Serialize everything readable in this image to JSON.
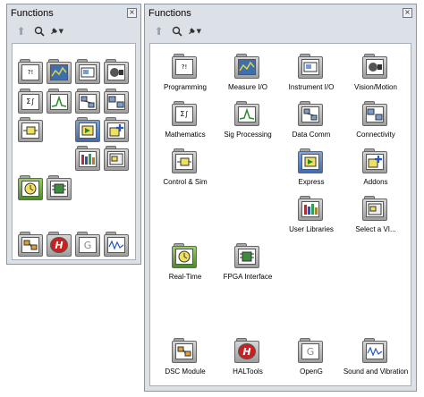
{
  "colors": {
    "window_bg": "#dce1e8",
    "content_bg": "#ffffff",
    "border": "#8a96a6",
    "folder_gray": "#b5b5b5",
    "hal_red": "#cc1f1f",
    "express_blue": "#1f5fbf",
    "addons_blue": "#2255cc",
    "fpga_green": "#3d8b3d",
    "measure_yellow": "#e8d040"
  },
  "small_window": {
    "title": "Functions",
    "close_icon": "close-icon",
    "toolbar": {
      "up_icon": "up-arrow-icon",
      "search_icon": "search-icon",
      "customize_icon": "wrench-icon"
    }
  },
  "large_window": {
    "title": "Functions",
    "close_icon": "close-icon",
    "toolbar": {
      "up_icon": "up-arrow-icon",
      "search_icon": "search-icon",
      "customize_icon": "wrench-icon"
    },
    "items": [
      {
        "label": "Programming",
        "icon": "programming-icon"
      },
      {
        "label": "Measure I/O",
        "icon": "measure-io-icon"
      },
      {
        "label": "Instrument I/O",
        "icon": "instrument-io-icon"
      },
      {
        "label": "Vision/Motion",
        "icon": "vision-motion-icon"
      },
      {
        "label": "Mathematics",
        "icon": "mathematics-icon"
      },
      {
        "label": "Sig Processing",
        "icon": "sig-processing-icon"
      },
      {
        "label": "Data Comm",
        "icon": "data-comm-icon"
      },
      {
        "label": "Connectivity",
        "icon": "connectivity-icon"
      },
      {
        "label": "Control & Sim",
        "icon": "control-sim-icon"
      },
      {
        "label": "Express",
        "icon": "express-icon"
      },
      {
        "label": "Addons",
        "icon": "addons-icon"
      },
      {
        "label": "User Libraries",
        "icon": "user-libraries-icon"
      },
      {
        "label": "Select a VI...",
        "icon": "select-vi-icon"
      },
      {
        "label": "Real-Time",
        "icon": "real-time-icon"
      },
      {
        "label": "FPGA Interface",
        "icon": "fpga-interface-icon"
      },
      {
        "label": "DSC Module",
        "icon": "dsc-module-icon"
      },
      {
        "label": "HALTools",
        "icon": "haltools-icon"
      },
      {
        "label": "OpenG",
        "icon": "openg-icon"
      },
      {
        "label": "Sound and Vibration",
        "icon": "sound-vibration-icon"
      }
    ]
  }
}
